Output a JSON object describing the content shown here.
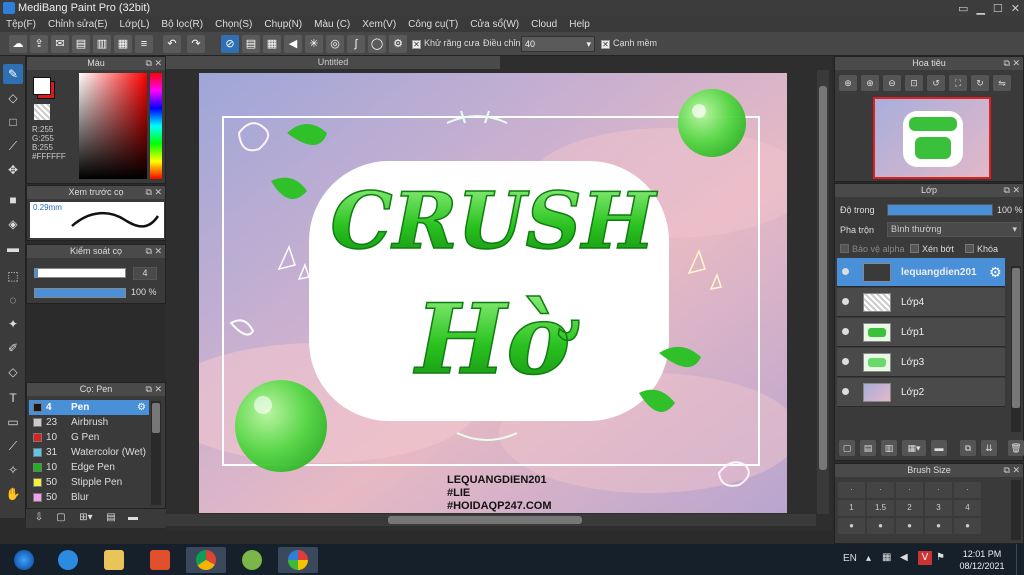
{
  "window": {
    "title": "MediBang Paint Pro (32bit)",
    "controls": [
      "▭",
      "▁",
      "☐",
      "✕"
    ]
  },
  "menu": [
    "Tệp(F)",
    "Chỉnh sửa(E)",
    "Lớp(L)",
    "Bộ lọc(R)",
    "Chọn(S)",
    "Chụp(N)",
    "Màu (C)",
    "Xem(V)",
    "Công cụ(T)",
    "Cửa sổ(W)",
    "Cloud",
    "Help"
  ],
  "toolbar": {
    "antialias_label": "Khử răng cưa",
    "adjust_label": "Điều chỉnh",
    "adjust_value": "40",
    "edge_label": "Cạnh mềm"
  },
  "color_panel": {
    "title": "Màu",
    "r": "R:255",
    "g": "G:255",
    "b": "B:255",
    "hex": "#FFFFFF",
    "fg": "#ffffff",
    "bg": "#d81b1b"
  },
  "brush_preview": {
    "title": "Xem trước cọ",
    "size": "0.29mm"
  },
  "brush_control": {
    "title": "Kiểm soát cọ",
    "size_value": "4",
    "opacity_value": "100 %"
  },
  "brush_list": {
    "title": "Cọ: Pen",
    "items": [
      {
        "size": "4",
        "name": "Pen",
        "color": "#1a1a1a"
      },
      {
        "size": "23",
        "name": "Airbrush",
        "color": "#cccccc"
      },
      {
        "size": "10",
        "name": "G Pen",
        "color": "#e02020"
      },
      {
        "size": "31",
        "name": "Watercolor (Wet)",
        "color": "#5ec4e8"
      },
      {
        "size": "10",
        "name": "Edge Pen",
        "color": "#1db31d"
      },
      {
        "size": "50",
        "name": "Stipple Pen",
        "color": "#f2f23a"
      },
      {
        "size": "50",
        "name": "Blur",
        "color": "#f2a0e8"
      }
    ]
  },
  "canvas": {
    "tab_title": "Untitled",
    "text_line1": "LEQUANGDIEN201",
    "text_line2": "#LIE",
    "text_line3": "#HOIDAQP247.COM",
    "art_word1": "CRUSH",
    "art_word2": "Hờ"
  },
  "navigator": {
    "title": "Hoa tiêu"
  },
  "layers": {
    "title": "Lớp",
    "opacity_label": "Độ trong",
    "opacity_value": "100 %",
    "opacity_fraction": 1.0,
    "blend_label": "Pha trộn",
    "blend_value": "Bình thường",
    "protect_alpha": "Bảo vệ alpha",
    "clip": "Xén bớt",
    "lock": "Khóa",
    "items": [
      {
        "name": "lequangdien201"
      },
      {
        "name": "Lớp4"
      },
      {
        "name": "Lớp1"
      },
      {
        "name": "Lớp3"
      },
      {
        "name": "Lớp2"
      }
    ]
  },
  "brush_size": {
    "title": "Brush Size",
    "labels": [
      "1",
      "1.5",
      "2",
      "3",
      "4"
    ]
  },
  "taskbar": {
    "lang": "EN",
    "time": "12:01 PM",
    "date": "08/12/2021"
  }
}
